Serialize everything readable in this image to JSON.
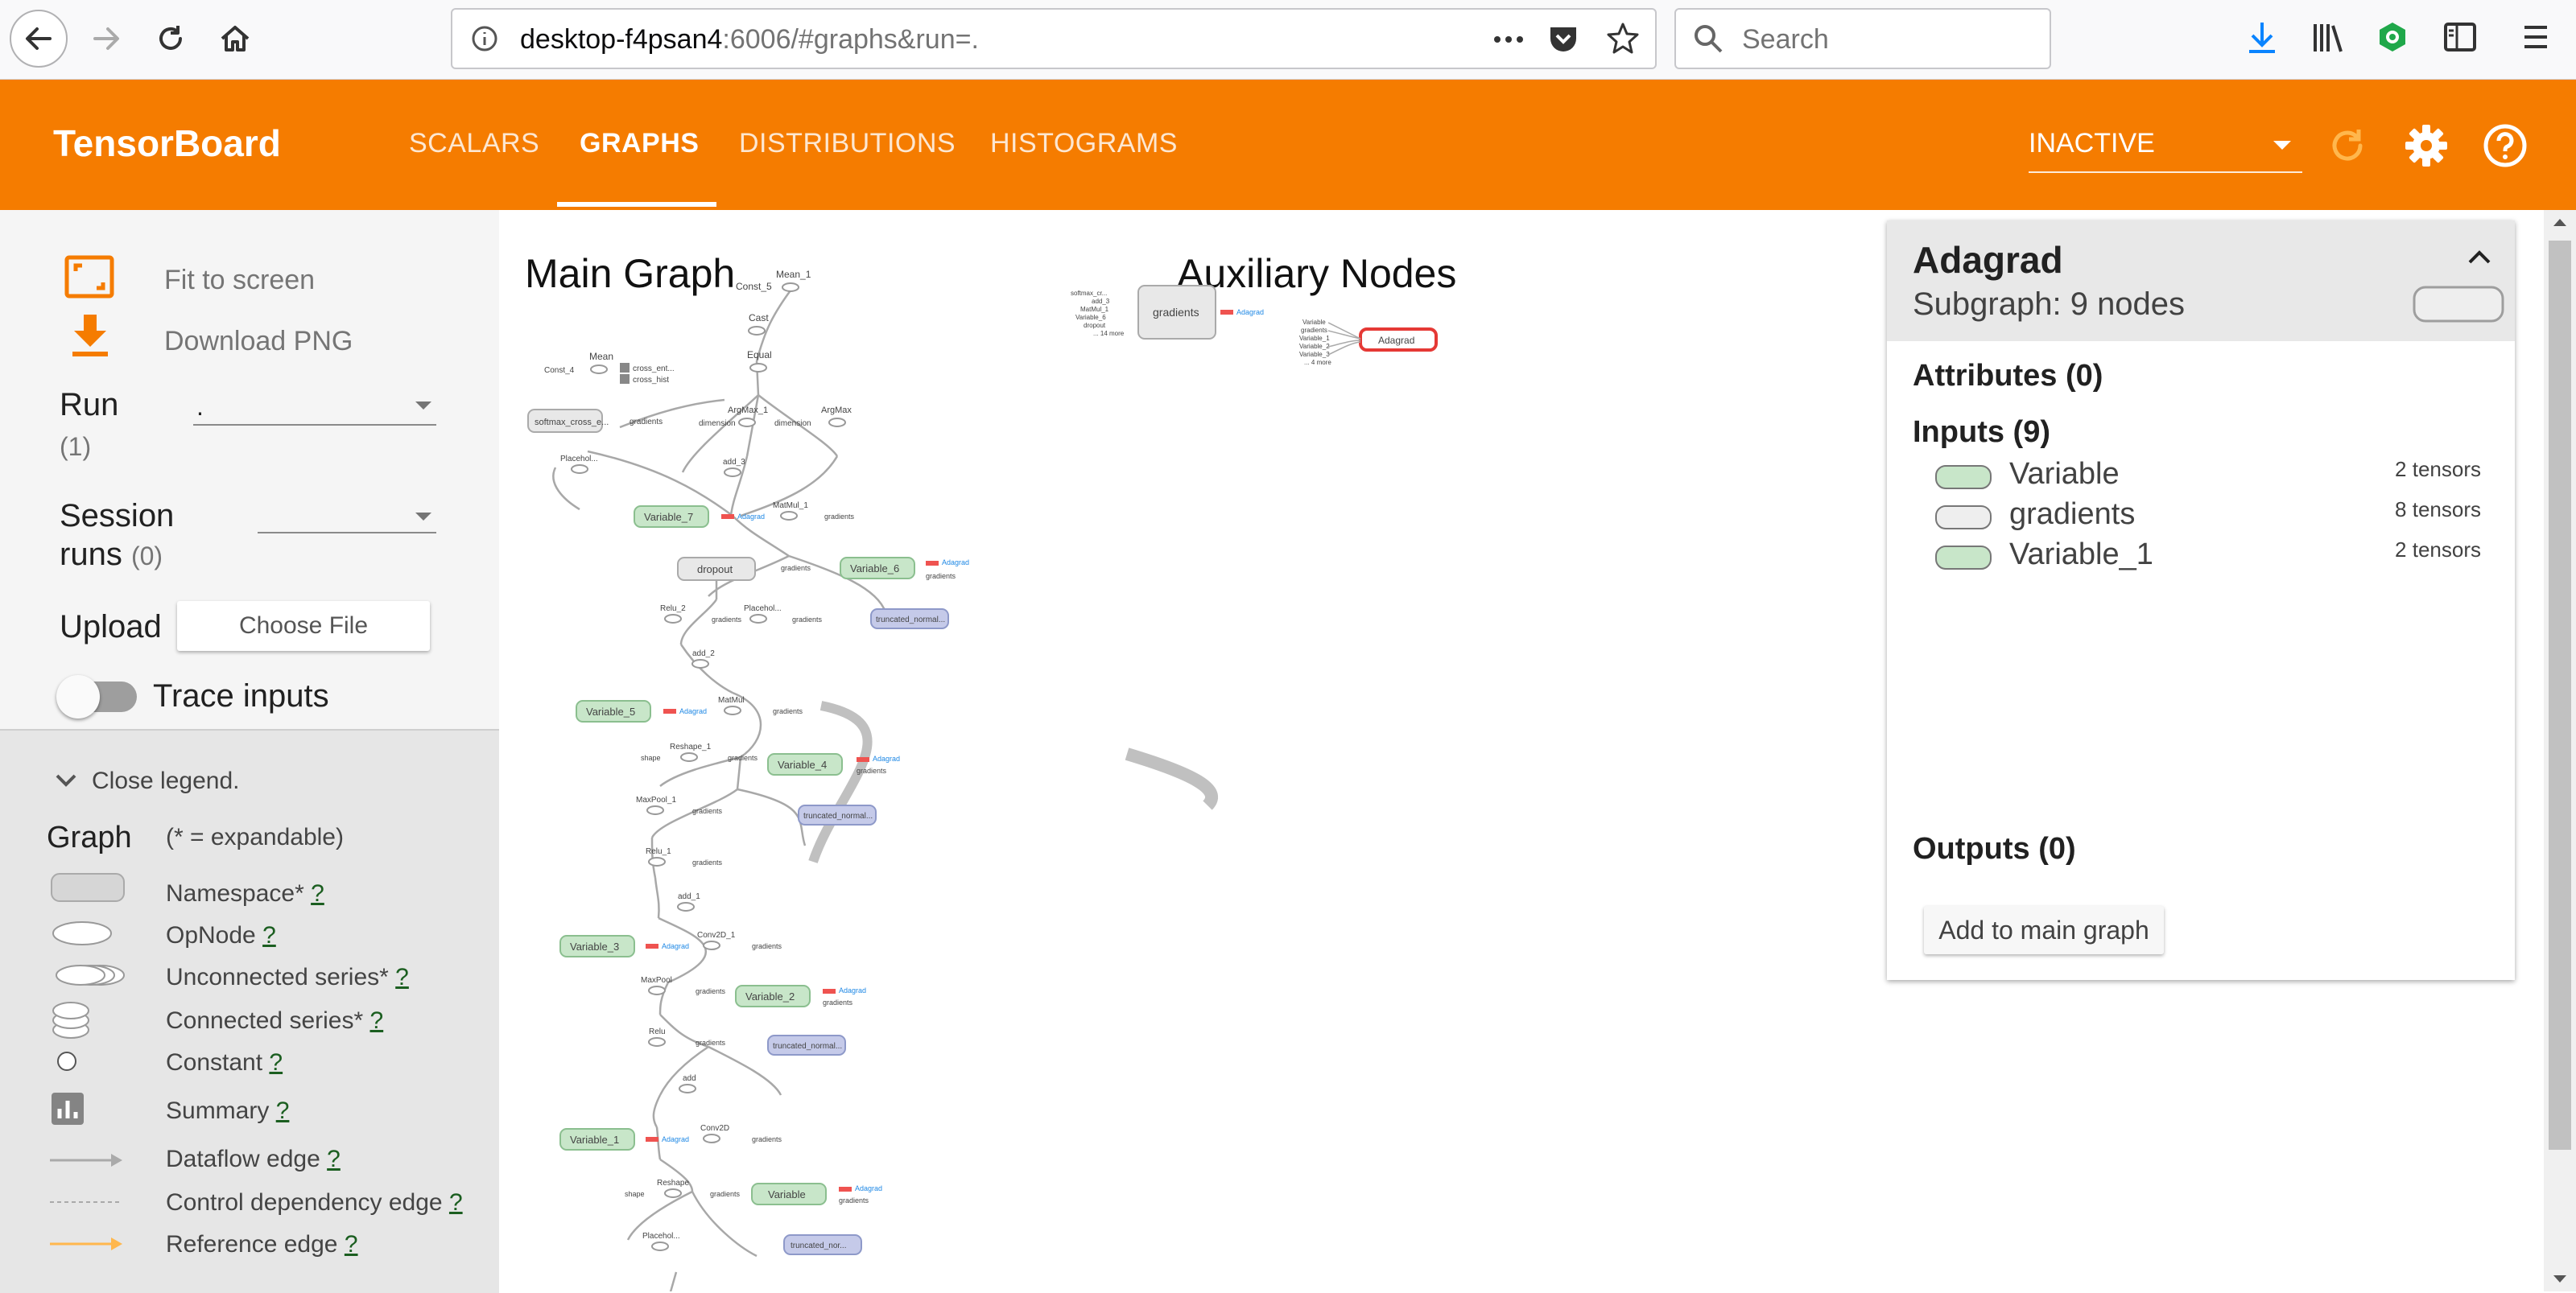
{
  "browser": {
    "url_host": "desktop-f4psan4",
    "url_rest": ":6006/#graphs&run=.",
    "search_placeholder": "Search"
  },
  "header": {
    "title": "TensorBoard",
    "tabs": [
      "SCALARS",
      "GRAPHS",
      "DISTRIBUTIONS",
      "HISTOGRAMS"
    ],
    "active_tab": "GRAPHS",
    "status_select": "INACTIVE"
  },
  "sidebar": {
    "fit_to_screen": "Fit to screen",
    "download_png": "Download PNG",
    "run_label": "Run",
    "run_value": ".",
    "run_count": "(1)",
    "session_label_1": "Session",
    "session_label_2": "runs",
    "session_count": "(0)",
    "upload_label": "Upload",
    "choose_file": "Choose File",
    "trace_inputs": "Trace inputs"
  },
  "legend": {
    "close_legend": "Close legend.",
    "graph_label": "Graph",
    "expandable_note": "(* = expandable)",
    "items": [
      "Namespace*",
      "OpNode",
      "Unconnected series*",
      "Connected series*",
      "Constant",
      "Summary",
      "Dataflow edge",
      "Control dependency edge",
      "Reference edge"
    ],
    "help_mark": "?"
  },
  "canvas": {
    "main_graph_title": "Main Graph",
    "aux_title": "Auxiliary Nodes",
    "graph_nodes": {
      "mean_1": "Mean_1",
      "const_5": "Const_5",
      "cast": "Cast",
      "equal": "Equal",
      "mean": "Mean",
      "const_4": "Const_4",
      "cross_ent": "cross_ent...",
      "cross_hist": "cross_hist",
      "softmax": "softmax_cross_e...",
      "gradients": "gradients",
      "argmax_1": "ArgMax_1",
      "argmax": "ArgMax",
      "dimension": "dimension",
      "placeholder": "Placehol...",
      "add_3": "add_3",
      "variable_7": "Variable_7",
      "adagrad": "Adagrad",
      "matmul_1": "MatMul_1",
      "dropout": "dropout",
      "variable_6": "Variable_6",
      "relu_2": "Relu_2",
      "truncated_normal": "truncated_normal...",
      "add_2": "add_2",
      "variable_5": "Variable_5",
      "matmul": "MatMul",
      "reshape_1": "Reshape_1",
      "shape": "shape",
      "variable_4": "Variable_4",
      "maxpool_1": "MaxPool_1",
      "truncated_normal2": "truncated_normal...",
      "relu_1": "Relu_1",
      "add_1": "add_1",
      "variable_3": "Variable_3",
      "conv2d_1": "Conv2D_1",
      "maxpool": "MaxPool",
      "variable_2": "Variable_2",
      "relu": "Relu",
      "truncated_normal3": "truncated_normal...",
      "add": "add",
      "variable_1": "Variable_1",
      "conv2d": "Conv2D",
      "reshape": "Reshape",
      "variable": "Variable",
      "placehol2": "Placehol...",
      "truncated_nor": "truncated_nor..."
    },
    "aux_nodes": {
      "gradients": "gradients",
      "adagrad": "Adagrad",
      "grad_inputs": [
        "softmax_cr...",
        "add_3",
        "MatMul_1",
        "Variable_6",
        "dropout",
        "... 14 more"
      ],
      "adagrad_inputs": [
        "Variable",
        "gradients",
        "Variable_1",
        "Variable_2",
        "Variable_3",
        "... 4 more"
      ]
    }
  },
  "info_card": {
    "title": "Adagrad",
    "subtitle": "Subgraph: 9 nodes",
    "attributes": "Attributes (0)",
    "inputs": "Inputs (9)",
    "input_items": [
      {
        "name": "Variable",
        "count": "2 tensors",
        "color": "#c8e6c9"
      },
      {
        "name": "gradients",
        "count": "8 tensors",
        "color": "#eeeeee"
      },
      {
        "name": "Variable_1",
        "count": "2 tensors",
        "color": "#c8e6c9"
      }
    ],
    "outputs": "Outputs (0)",
    "add_to_main": "Add to main graph"
  },
  "colors": {
    "header_orange": "#f57c00",
    "variable_fill": "#c8e6c9",
    "namespace_fill": "#e0e0e0",
    "truncated_fill": "#c5cae9",
    "selected_outline": "#e53935",
    "reference_edge": "#ffb74d"
  }
}
